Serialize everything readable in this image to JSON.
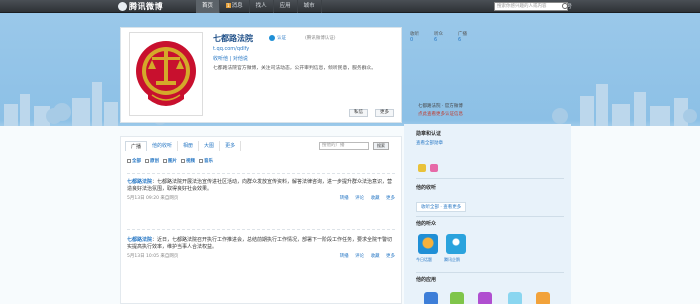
{
  "topbar": {
    "logo": "腾讯微博",
    "nav": [
      {
        "label": "首页",
        "active": true
      },
      {
        "label": "消息",
        "badge": "1"
      },
      {
        "label": "找人"
      },
      {
        "label": "应用"
      },
      {
        "label": "城市"
      }
    ],
    "notifications": "1",
    "account_link": "微博账号",
    "search_placeholder": "搜索你感兴趣的人或内容"
  },
  "profile": {
    "name": "七都路法院",
    "verify_label": "认证",
    "hint": "(腾讯微博认证)",
    "handle": "t.qq.com/qdlfy",
    "links": "收听他 | 对他说",
    "description": "七都路法院官方微博，关注司法动态，公开审判信息，倾听民意，服务群众。",
    "buttons": [
      "私信",
      "更多"
    ]
  },
  "stats": {
    "items": [
      {
        "label": "收听",
        "value": "0"
      },
      {
        "label": "听众",
        "value": "6"
      },
      {
        "label": "广播",
        "value": "6"
      }
    ],
    "line1": "七都路法院 · 官方微博",
    "line2": "点此查看更多认证信息"
  },
  "feed": {
    "tabs": [
      "广播",
      "他的收听",
      "相册",
      "大图",
      "更多"
    ],
    "search_placeholder": "搜他的广播",
    "search_button": "搜索",
    "filters": [
      "全部",
      "原创",
      "图片",
      "视频",
      "音乐"
    ],
    "posts": [
      {
        "author": "七都路法院",
        "text": "：七都路法院开展法治宣传进社区活动，向群众发放宣传资料，解答法律咨询，进一步提升群众法治意识，营造良好法治氛围，取得良好社会效果。",
        "time": "5月13日 09:20 来自网页",
        "actions": [
          "转播",
          "评论",
          "收藏",
          "更多"
        ]
      },
      {
        "author": "七都路法院",
        "text": "：近日，七都路法院召开执行工作推进会，总结前期执行工作情况，部署下一阶段工作任务，要求全院干警切实提高执行效率，维护当事人合法权益。",
        "time": "5月13日 10:05 来自网页",
        "actions": [
          "转播",
          "评论",
          "收藏",
          "更多"
        ]
      }
    ]
  },
  "sidebar": {
    "medal_title": "勋章和认证",
    "medal_link": "查看全部勋章",
    "listen_title": "他的收听",
    "listen_link": "收听全部 · 查看更多",
    "audience_title": "他的听众",
    "audience": [
      {
        "name": "今日话题"
      },
      {
        "name": "腾讯企鹅"
      }
    ],
    "apps_title": "他的应用"
  }
}
